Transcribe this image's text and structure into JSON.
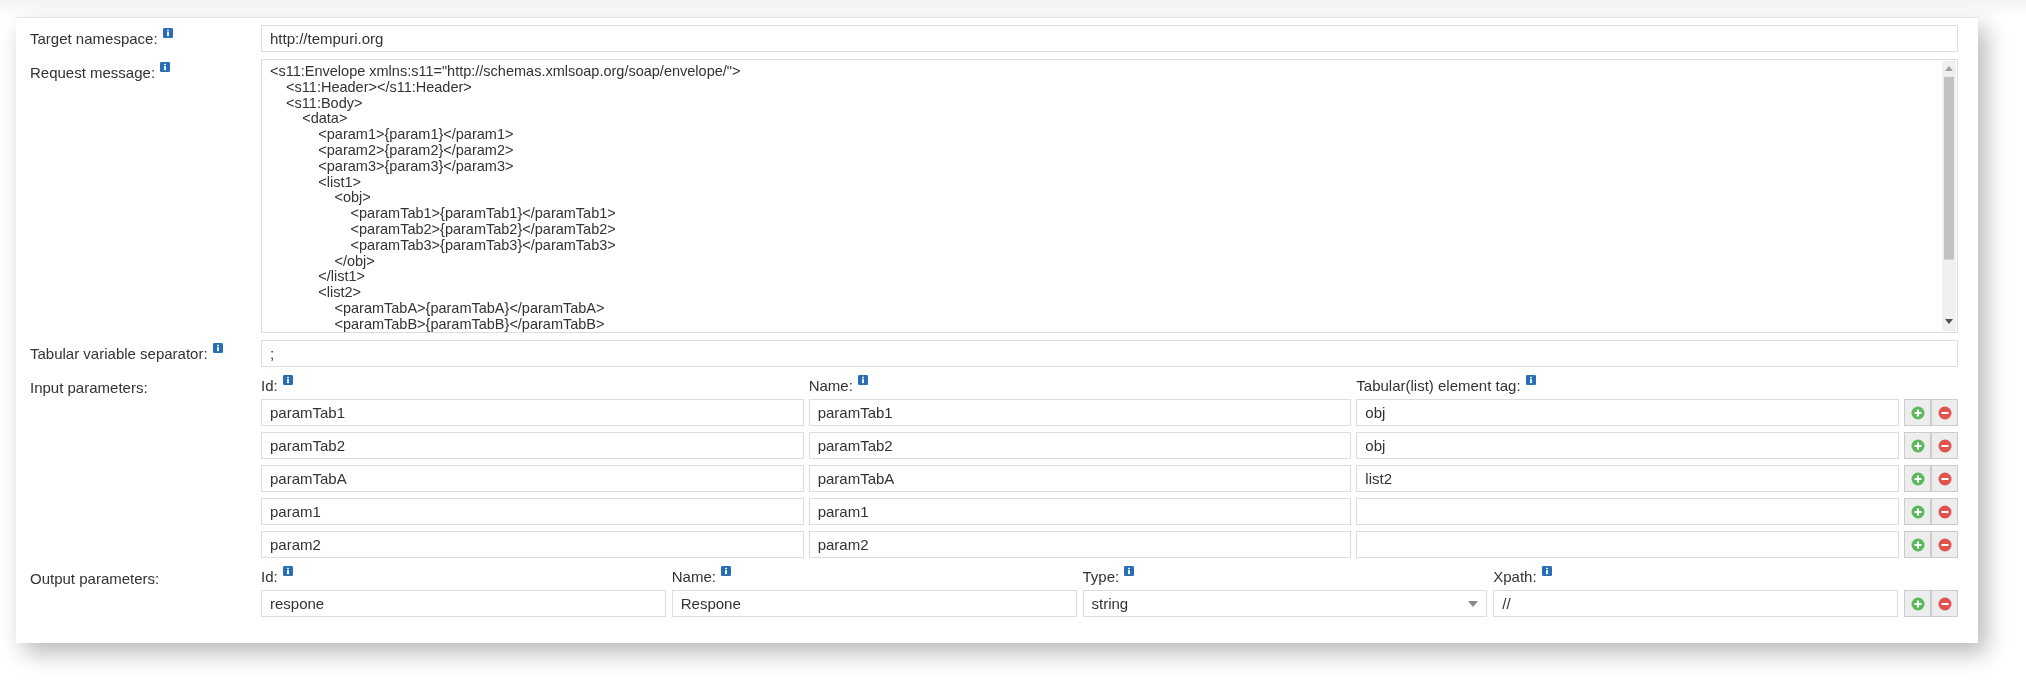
{
  "target_namespace": {
    "label": "Target namespace:",
    "value": "http://tempuri.org"
  },
  "request_message": {
    "label": "Request message:",
    "lines": [
      "<s11:Envelope xmlns:s11=\"http://schemas.xmlsoap.org/soap/envelope/\">",
      "    <s11:Header></s11:Header>",
      "    <s11:Body>",
      "        <data>",
      "            <param1>{param1}</param1>",
      "            <param2>{param2}</param2>",
      "            <param3>{param3}</param3>",
      "            <list1>",
      "                <obj>",
      "                    <paramTab1>{paramTab1}</paramTab1>",
      "                    <paramTab2>{paramTab2}</paramTab2>",
      "                    <paramTab3>{paramTab3}</paramTab3>",
      "                </obj>",
      "            </list1>",
      "            <list2>",
      "                <paramTabA>{paramTabA}</paramTabA>",
      "                <paramTabB>{paramTabB}</paramTabB>"
    ]
  },
  "separator": {
    "label": "Tabular variable separator:",
    "value": ";"
  },
  "input_parameters": {
    "label": "Input parameters:",
    "columns": [
      "Id:",
      "Name:",
      "Tabular(list) element tag:"
    ],
    "rows": [
      {
        "id": "paramTab1",
        "name": "paramTab1",
        "tag": "obj"
      },
      {
        "id": "paramTab2",
        "name": "paramTab2",
        "tag": "obj"
      },
      {
        "id": "paramTabA",
        "name": "paramTabA",
        "tag": "list2"
      },
      {
        "id": "param1",
        "name": "param1",
        "tag": ""
      },
      {
        "id": "param2",
        "name": "param2",
        "tag": ""
      }
    ]
  },
  "output_parameters": {
    "label": "Output parameters:",
    "columns": [
      "Id:",
      "Name:",
      "Type:",
      "Xpath:"
    ],
    "rows": [
      {
        "id": "respone",
        "name": "Respone",
        "type": "string",
        "xpath": "//"
      }
    ]
  }
}
